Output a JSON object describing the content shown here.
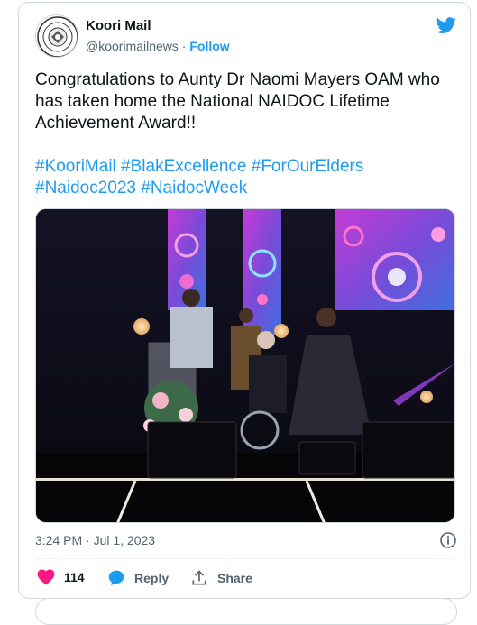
{
  "account": {
    "display_name": "Koori Mail",
    "handle": "@koorimailnews",
    "separator": " · ",
    "follow_label": "Follow"
  },
  "tweet": {
    "text": "Congratulations to Aunty Dr Naomi Mayers OAM who has taken home the National NAIDOC Lifetime Achievement Award!!",
    "hashtags": [
      "#KooriMail",
      "#BlakExcellence",
      "#ForOurElders",
      "#Naidoc2023",
      "#NaidocWeek"
    ],
    "timestamp": "3:24 PM · Jul 1, 2023"
  },
  "actions": {
    "like_count": "114",
    "reply_label": "Reply",
    "share_label": "Share"
  },
  "colors": {
    "brand_blue": "#1d9bf0",
    "like_pink": "#f91880",
    "text_primary": "#0f1419",
    "text_secondary": "#536471"
  },
  "icons": {
    "avatar": "koori-mail-logo",
    "bird": "twitter-bird-icon",
    "info": "info-icon",
    "like": "heart-icon",
    "reply": "speech-bubble-icon",
    "share": "share-upload-icon"
  }
}
